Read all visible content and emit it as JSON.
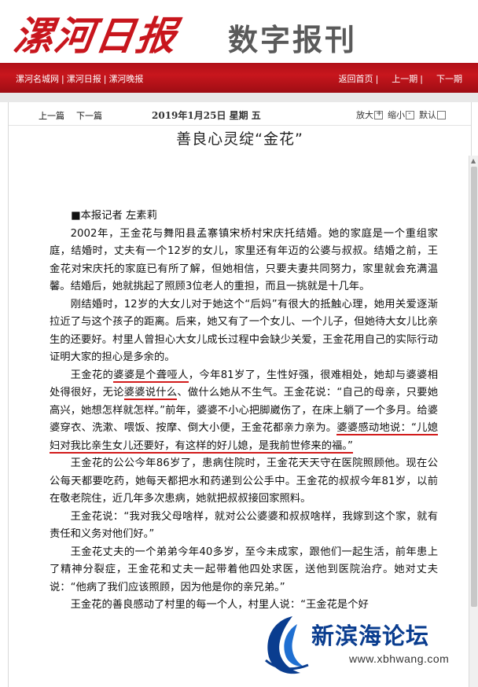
{
  "header": {
    "logo_text": "漯河日报",
    "subtitle": "数字报刊"
  },
  "nav": {
    "left": [
      "漯河名城网",
      "漯河日报",
      "漯河晚报"
    ],
    "right": [
      "返回首页",
      "上一期",
      "下一期"
    ],
    "separator": "|"
  },
  "toolbar": {
    "prev": "上一篇",
    "next": "下一篇",
    "date": "2019年1月25日  星期 五",
    "zoom_in": "放大",
    "zoom_out": "缩小",
    "default": "默认"
  },
  "article": {
    "title": "善良心灵绽“金花”",
    "byline": "■本报记者 左素莉",
    "p1": "2002年，王金花与舞阳县孟寨镇宋桥村宋庆托结婚。她的家庭是一个重组家庭，结婚时，丈夫有一个12岁的女儿，家里还有年迈的公婆与叔叔。结婚之前，王金花对宋庆托的家庭已有所了解，但她相信，只要夫妻共同努力，家里就会充满温馨。结婚后，她就挑起了照顾3位老人的重担，而且一挑就是十几年。",
    "p2": "刚结婚时，12岁的大女儿对于她这个“后妈”有很大的抵触心理，她用关爱逐渐拉近了与这个孩子的距离。后来，她又有了一个女儿、一个儿子，但她待大女儿比亲生的还要好。村里人曾担心大女儿成长过程中会缺少关爱，王金花用自己的实际行动证明大家的担心是多余的。",
    "p3_a": "王金花的",
    "p3_hl1": "婆婆是个聋哑人",
    "p3_b": "，今年81岁了，生性好强，很难相处，她却与婆婆相处得很好，无论",
    "p3_hl2": "婆婆说什么",
    "p3_c": "、做什么她从不生气。王金花说：“自己的母亲，只要她高兴，她想怎样就怎样。”前年，婆婆不小心把脚崴伤了，在床上躺了一个多月。给婆婆穿衣、洗漱、喂饭、按摩、倒大小便，王金花都亲力亲为。",
    "p3_hl3": "婆婆感动地说：“儿媳妇对我比亲生女儿还要好，有这样的好儿媳，是我前世修来的福。”",
    "p4": "王金花的公公今年86岁了，患病住院时，王金花天天守在医院照顾他。现在公公每天都要吃药，她每天都把水和药递到公公手中。王金花的叔叔今年81岁，以前在敬老院住，近几年多次患病，她就把叔叔接回家照料。",
    "p5": "王金花说：“我对我父母啥样，就对公公婆婆和叔叔啥样，我嫁到这个家，就有责任和义务对他们好。”",
    "p6": "王金花丈夫的一个弟弟今年40多岁，至今未成家，跟他们一起生活，前年患上了精神分裂症，王金花和丈夫一起带着他四处求医，送他到医院治疗。她对丈夫说：“他病了我们应该照顾，因为他是你的亲兄弟。”",
    "p7": "王金花的善良感动了村里的每一个人，村里人说：“王金花是个好"
  },
  "watermark": {
    "name": "新滨海论坛",
    "url": "www.xbhwang.com"
  },
  "colors": {
    "brand_red": "#c8161d",
    "highlight_underline": "#d21b1b",
    "watermark_blue": "#0a3d8f"
  }
}
